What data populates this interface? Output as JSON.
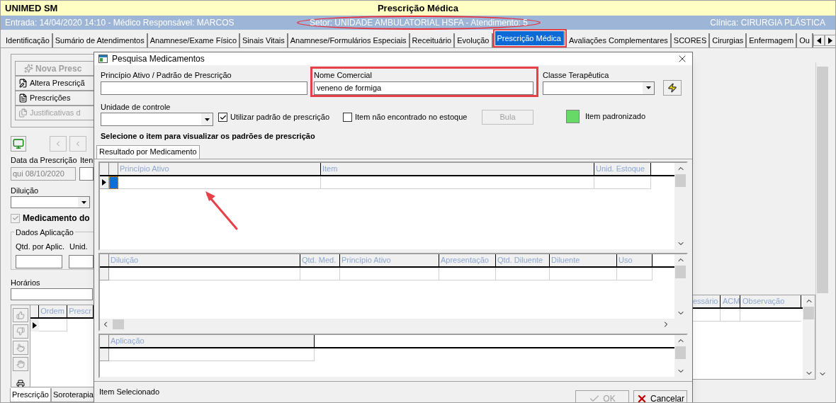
{
  "app": {
    "name": "UNIMED SM",
    "title": "Prescrição Médica"
  },
  "info_bar": {
    "entry": "Entrada: 14/04/2020 14:10 - Médico Responsável: MARCOS",
    "sector": "Setor: UNIDADE AMBULATORIAL HSFA - Atendimento: 5",
    "clinic": "Clínica: CIRURGIA PLÁSTICA"
  },
  "tabs": [
    {
      "label": "Identificação",
      "selected": false
    },
    {
      "label": "Sumário de Atendimentos",
      "selected": false
    },
    {
      "label": "Anamnese/Exame Físico",
      "selected": false
    },
    {
      "label": "Sinais Vitais",
      "selected": false
    },
    {
      "label": "Anamnese/Formulários Especiais",
      "selected": false
    },
    {
      "label": "Receituário",
      "selected": false
    },
    {
      "label": "Evolução",
      "selected": false
    },
    {
      "label": "Prescrição Médica",
      "selected": true
    },
    {
      "label": "Avaliações Complementares",
      "selected": false
    },
    {
      "label": "SCORES",
      "selected": false
    },
    {
      "label": "Cirurgias",
      "selected": false
    },
    {
      "label": "Enfermagem",
      "selected": false
    },
    {
      "label": "Ou",
      "selected": false
    }
  ],
  "left_panel": {
    "buttons": [
      {
        "label": "Nova Presc",
        "kind": "primary",
        "disabled": true
      },
      {
        "label": "Altera Prescriçã",
        "kind": "edit",
        "disabled": false
      },
      {
        "label": "Prescrições",
        "kind": "list",
        "disabled": false
      },
      {
        "label": "Justificativas d",
        "kind": "docs",
        "disabled": true
      }
    ],
    "date_label": "Data da Prescrição",
    "items_label": "Iten",
    "date_value": "qui 08/10/2020",
    "dilution_label": "Diluição",
    "medication_checkbox": {
      "label": "Medicamento do",
      "checked": true,
      "disabled": true
    },
    "group_title": "Dados Aplicação",
    "qty_label": "Qtd. por Aplic.",
    "unit_label": "Unid.",
    "schedule_label": "Horários",
    "grid_columns": [
      "Ordem",
      "Prescr"
    ],
    "bottom_tabs": [
      {
        "label": "Prescrição",
        "selected": true
      },
      {
        "label": "Soroterapia",
        "selected": false
      }
    ]
  },
  "right_grid": {
    "columns": [
      "essário",
      "ACM",
      "Observação"
    ]
  },
  "dialog": {
    "title": "Pesquisa Medicamentos",
    "active_ingredient": {
      "label": "Princípio Ativo / Padrão de Prescrição"
    },
    "trade_name": {
      "label": "Nome Comercial",
      "value": "veneno de formiga"
    },
    "therapeutic_class": {
      "label": "Classe Terapêutica"
    },
    "control_unit": {
      "label": "Unidade de controle"
    },
    "checkboxes": [
      {
        "label": "Utilizar padrão de prescrição",
        "checked": true
      },
      {
        "label": "Item não encontrado no estoque",
        "checked": false
      }
    ],
    "leaflet_button": {
      "label": "Bula",
      "disabled": true
    },
    "legend": {
      "label": "Item padronizado"
    },
    "instruction": "Selecione o item para visualizar os padrões de prescrição",
    "result_tabs": [
      {
        "label": "Resultado por Medicamento",
        "selected": true
      }
    ],
    "grids": [
      {
        "columns": [
          "Princípio Ativo",
          "Item",
          "Unid. Estoque"
        ],
        "current_row": true
      },
      {
        "columns": [
          "Diluição",
          "Qtd. Med.",
          "Princípio Ativo",
          "Apresentação",
          "Qtd. Diluente",
          "Diluente",
          "Uso"
        ],
        "current_row": false
      },
      {
        "columns": [
          "Aplicação"
        ],
        "current_row": false
      }
    ],
    "status": "Item Selecionado",
    "buttons": [
      {
        "label": "OK",
        "kind": "ok",
        "disabled": true
      },
      {
        "label": "Cancelar",
        "kind": "cancel",
        "disabled": false
      }
    ]
  }
}
